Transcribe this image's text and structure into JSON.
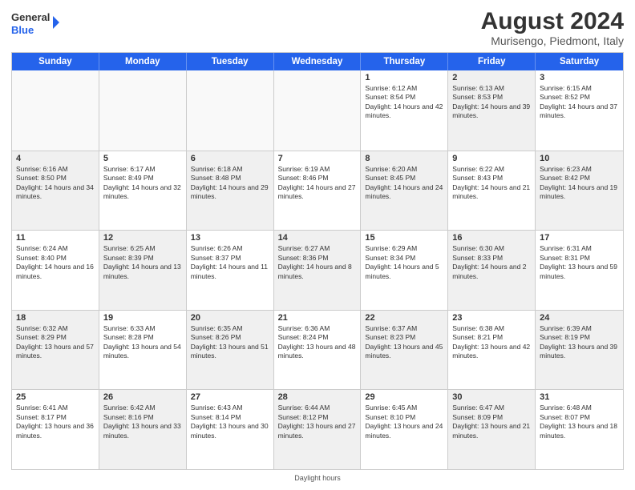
{
  "header": {
    "logo_line1": "General",
    "logo_line2": "Blue",
    "main_title": "August 2024",
    "subtitle": "Murisengo, Piedmont, Italy"
  },
  "calendar": {
    "days_of_week": [
      "Sunday",
      "Monday",
      "Tuesday",
      "Wednesday",
      "Thursday",
      "Friday",
      "Saturday"
    ],
    "weeks": [
      [
        {
          "day": "",
          "empty": true,
          "shaded": false,
          "text": ""
        },
        {
          "day": "",
          "empty": true,
          "shaded": false,
          "text": ""
        },
        {
          "day": "",
          "empty": true,
          "shaded": false,
          "text": ""
        },
        {
          "day": "",
          "empty": true,
          "shaded": false,
          "text": ""
        },
        {
          "day": "1",
          "empty": false,
          "shaded": false,
          "text": "Sunrise: 6:12 AM\nSunset: 8:54 PM\nDaylight: 14 hours and 42 minutes."
        },
        {
          "day": "2",
          "empty": false,
          "shaded": true,
          "text": "Sunrise: 6:13 AM\nSunset: 8:53 PM\nDaylight: 14 hours and 39 minutes."
        },
        {
          "day": "3",
          "empty": false,
          "shaded": false,
          "text": "Sunrise: 6:15 AM\nSunset: 8:52 PM\nDaylight: 14 hours and 37 minutes."
        }
      ],
      [
        {
          "day": "4",
          "empty": false,
          "shaded": true,
          "text": "Sunrise: 6:16 AM\nSunset: 8:50 PM\nDaylight: 14 hours and 34 minutes."
        },
        {
          "day": "5",
          "empty": false,
          "shaded": false,
          "text": "Sunrise: 6:17 AM\nSunset: 8:49 PM\nDaylight: 14 hours and 32 minutes."
        },
        {
          "day": "6",
          "empty": false,
          "shaded": true,
          "text": "Sunrise: 6:18 AM\nSunset: 8:48 PM\nDaylight: 14 hours and 29 minutes."
        },
        {
          "day": "7",
          "empty": false,
          "shaded": false,
          "text": "Sunrise: 6:19 AM\nSunset: 8:46 PM\nDaylight: 14 hours and 27 minutes."
        },
        {
          "day": "8",
          "empty": false,
          "shaded": true,
          "text": "Sunrise: 6:20 AM\nSunset: 8:45 PM\nDaylight: 14 hours and 24 minutes."
        },
        {
          "day": "9",
          "empty": false,
          "shaded": false,
          "text": "Sunrise: 6:22 AM\nSunset: 8:43 PM\nDaylight: 14 hours and 21 minutes."
        },
        {
          "day": "10",
          "empty": false,
          "shaded": true,
          "text": "Sunrise: 6:23 AM\nSunset: 8:42 PM\nDaylight: 14 hours and 19 minutes."
        }
      ],
      [
        {
          "day": "11",
          "empty": false,
          "shaded": false,
          "text": "Sunrise: 6:24 AM\nSunset: 8:40 PM\nDaylight: 14 hours and 16 minutes."
        },
        {
          "day": "12",
          "empty": false,
          "shaded": true,
          "text": "Sunrise: 6:25 AM\nSunset: 8:39 PM\nDaylight: 14 hours and 13 minutes."
        },
        {
          "day": "13",
          "empty": false,
          "shaded": false,
          "text": "Sunrise: 6:26 AM\nSunset: 8:37 PM\nDaylight: 14 hours and 11 minutes."
        },
        {
          "day": "14",
          "empty": false,
          "shaded": true,
          "text": "Sunrise: 6:27 AM\nSunset: 8:36 PM\nDaylight: 14 hours and 8 minutes."
        },
        {
          "day": "15",
          "empty": false,
          "shaded": false,
          "text": "Sunrise: 6:29 AM\nSunset: 8:34 PM\nDaylight: 14 hours and 5 minutes."
        },
        {
          "day": "16",
          "empty": false,
          "shaded": true,
          "text": "Sunrise: 6:30 AM\nSunset: 8:33 PM\nDaylight: 14 hours and 2 minutes."
        },
        {
          "day": "17",
          "empty": false,
          "shaded": false,
          "text": "Sunrise: 6:31 AM\nSunset: 8:31 PM\nDaylight: 13 hours and 59 minutes."
        }
      ],
      [
        {
          "day": "18",
          "empty": false,
          "shaded": true,
          "text": "Sunrise: 6:32 AM\nSunset: 8:29 PM\nDaylight: 13 hours and 57 minutes."
        },
        {
          "day": "19",
          "empty": false,
          "shaded": false,
          "text": "Sunrise: 6:33 AM\nSunset: 8:28 PM\nDaylight: 13 hours and 54 minutes."
        },
        {
          "day": "20",
          "empty": false,
          "shaded": true,
          "text": "Sunrise: 6:35 AM\nSunset: 8:26 PM\nDaylight: 13 hours and 51 minutes."
        },
        {
          "day": "21",
          "empty": false,
          "shaded": false,
          "text": "Sunrise: 6:36 AM\nSunset: 8:24 PM\nDaylight: 13 hours and 48 minutes."
        },
        {
          "day": "22",
          "empty": false,
          "shaded": true,
          "text": "Sunrise: 6:37 AM\nSunset: 8:23 PM\nDaylight: 13 hours and 45 minutes."
        },
        {
          "day": "23",
          "empty": false,
          "shaded": false,
          "text": "Sunrise: 6:38 AM\nSunset: 8:21 PM\nDaylight: 13 hours and 42 minutes."
        },
        {
          "day": "24",
          "empty": false,
          "shaded": true,
          "text": "Sunrise: 6:39 AM\nSunset: 8:19 PM\nDaylight: 13 hours and 39 minutes."
        }
      ],
      [
        {
          "day": "25",
          "empty": false,
          "shaded": false,
          "text": "Sunrise: 6:41 AM\nSunset: 8:17 PM\nDaylight: 13 hours and 36 minutes."
        },
        {
          "day": "26",
          "empty": false,
          "shaded": true,
          "text": "Sunrise: 6:42 AM\nSunset: 8:16 PM\nDaylight: 13 hours and 33 minutes."
        },
        {
          "day": "27",
          "empty": false,
          "shaded": false,
          "text": "Sunrise: 6:43 AM\nSunset: 8:14 PM\nDaylight: 13 hours and 30 minutes."
        },
        {
          "day": "28",
          "empty": false,
          "shaded": true,
          "text": "Sunrise: 6:44 AM\nSunset: 8:12 PM\nDaylight: 13 hours and 27 minutes."
        },
        {
          "day": "29",
          "empty": false,
          "shaded": false,
          "text": "Sunrise: 6:45 AM\nSunset: 8:10 PM\nDaylight: 13 hours and 24 minutes."
        },
        {
          "day": "30",
          "empty": false,
          "shaded": true,
          "text": "Sunrise: 6:47 AM\nSunset: 8:09 PM\nDaylight: 13 hours and 21 minutes."
        },
        {
          "day": "31",
          "empty": false,
          "shaded": false,
          "text": "Sunrise: 6:48 AM\nSunset: 8:07 PM\nDaylight: 13 hours and 18 minutes."
        }
      ]
    ]
  },
  "footer": {
    "text": "Daylight hours"
  }
}
